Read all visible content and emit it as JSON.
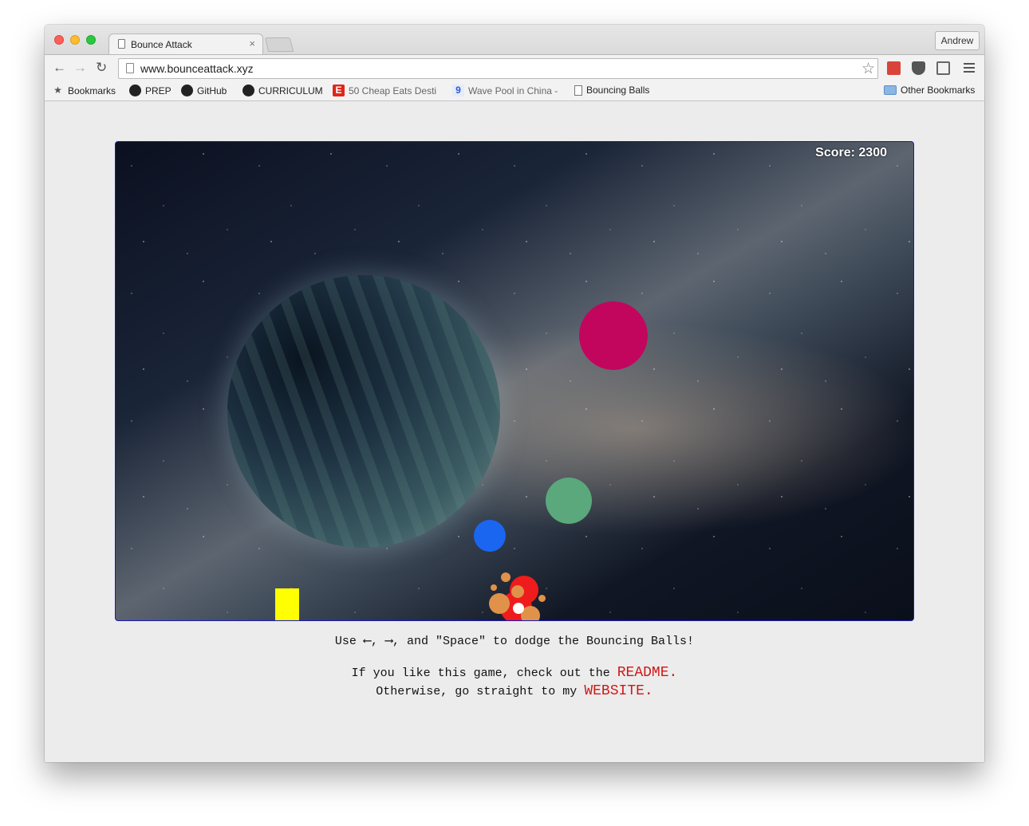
{
  "browser": {
    "tab_title": "Bounce Attack",
    "tab_close": "×",
    "profile_name": "Andrew",
    "url": "www.bounceattack.xyz",
    "nav": {
      "back": "←",
      "forward": "→",
      "reload": "↻",
      "star": "☆"
    }
  },
  "bookmarks": {
    "apps_label": "Bookmarks",
    "items": [
      {
        "label": "PREP",
        "icon": "github-icon"
      },
      {
        "label": "GitHub",
        "icon": "github-icon"
      },
      {
        "label": "CURRICULUM",
        "icon": "github-icon"
      },
      {
        "label": "50 Cheap Eats Desti",
        "icon": "eater-icon"
      },
      {
        "label": "Wave Pool in China -",
        "icon": "site-icon"
      },
      {
        "label": "Bouncing Balls",
        "icon": "page-icon"
      }
    ],
    "other": "Other Bookmarks"
  },
  "game": {
    "score_text": "Score: 2300",
    "ball_colors": {
      "magenta": "#c2065e",
      "green": "#5aa87c",
      "blue": "#1a66f0"
    }
  },
  "page": {
    "instructions": "Use ⟵, ⟶, and \"Space\" to dodge the Bouncing Balls!",
    "line1_text": "If you like this game, check out the ",
    "readme_link": "README.",
    "line2_text": "Otherwise, go straight to my ",
    "website_link": "WEBSITE."
  }
}
